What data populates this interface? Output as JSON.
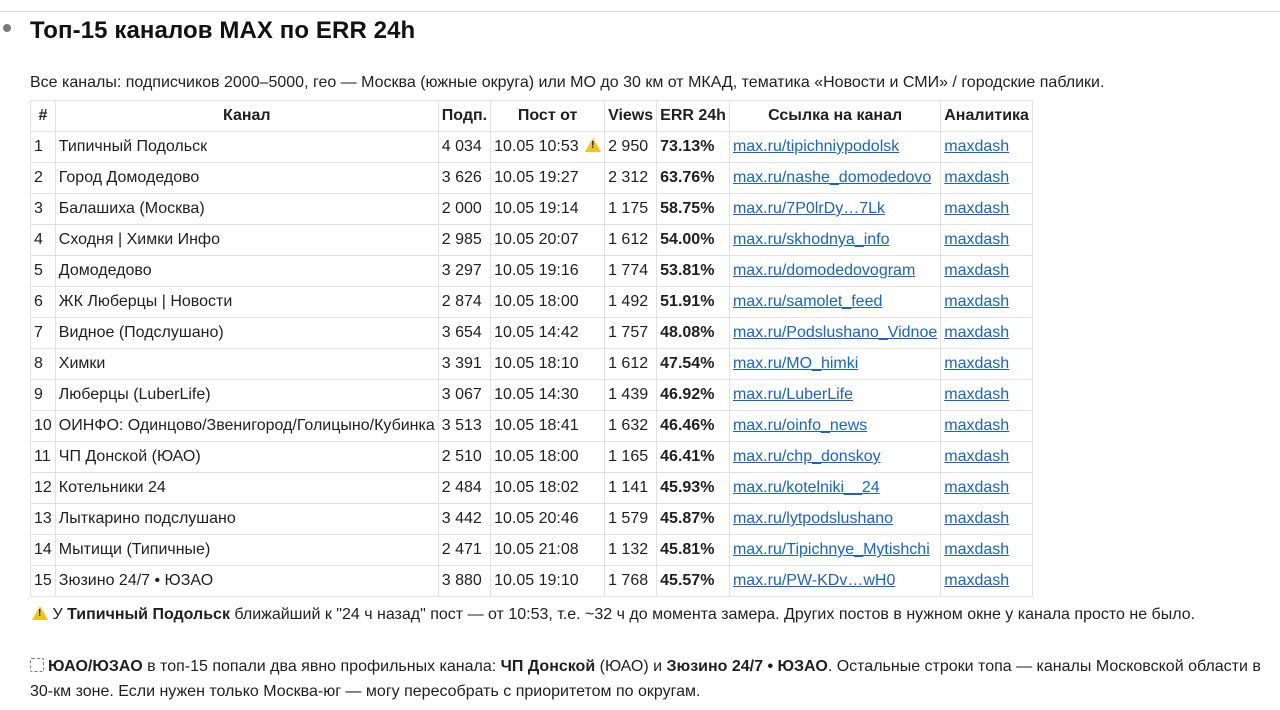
{
  "title": "Топ-15 каналов MAX по ERR 24h",
  "intro": "Все каналы: подписчиков 2000–5000, гео — Москва (южные округа) или МО до 30 км от МКАД, тематика «Новости и СМИ» / городские паблики.",
  "table": {
    "headers": [
      "#",
      "Канал",
      "Подп.",
      "Пост от",
      "Views",
      "ERR 24h",
      "Ссылка на канал",
      "Аналитика"
    ],
    "rows": [
      {
        "n": "1",
        "channel": "Типичный Подольск",
        "subs": "4 034",
        "post": "10.05 10:53",
        "warn": true,
        "views": "2 950",
        "err": "73.13%",
        "link": "max.ru/tipichniypodolsk",
        "analytics": "maxdash"
      },
      {
        "n": "2",
        "channel": "Город Домодедово",
        "subs": "3 626",
        "post": "10.05 19:27",
        "warn": false,
        "views": "2 312",
        "err": "63.76%",
        "link": "max.ru/nashe_domodedovo",
        "analytics": "maxdash"
      },
      {
        "n": "3",
        "channel": "Балашиха (Москва)",
        "subs": "2 000",
        "post": "10.05 19:14",
        "warn": false,
        "views": "1 175",
        "err": "58.75%",
        "link": "max.ru/7P0lrDy…7Lk",
        "analytics": "maxdash"
      },
      {
        "n": "4",
        "channel": "Сходня | Химки Инфо",
        "subs": "2 985",
        "post": "10.05 20:07",
        "warn": false,
        "views": "1 612",
        "err": "54.00%",
        "link": "max.ru/skhodnya_info",
        "analytics": "maxdash"
      },
      {
        "n": "5",
        "channel": "Домодедово",
        "subs": "3 297",
        "post": "10.05 19:16",
        "warn": false,
        "views": "1 774",
        "err": "53.81%",
        "link": "max.ru/domodedovogram",
        "analytics": "maxdash"
      },
      {
        "n": "6",
        "channel": "ЖК Люберцы | Новости",
        "subs": "2 874",
        "post": "10.05 18:00",
        "warn": false,
        "views": "1 492",
        "err": "51.91%",
        "link": "max.ru/samolet_feed",
        "analytics": "maxdash"
      },
      {
        "n": "7",
        "channel": "Видное (Подслушано)",
        "subs": "3 654",
        "post": "10.05 14:42",
        "warn": false,
        "views": "1 757",
        "err": "48.08%",
        "link": "max.ru/Podslushano_Vidnoe",
        "analytics": "maxdash"
      },
      {
        "n": "8",
        "channel": "Химки",
        "subs": "3 391",
        "post": "10.05 18:10",
        "warn": false,
        "views": "1 612",
        "err": "47.54%",
        "link": "max.ru/MO_himki",
        "analytics": "maxdash"
      },
      {
        "n": "9",
        "channel": "Люберцы (LuberLife)",
        "subs": "3 067",
        "post": "10.05 14:30",
        "warn": false,
        "views": "1 439",
        "err": "46.92%",
        "link": "max.ru/LuberLife",
        "analytics": "maxdash"
      },
      {
        "n": "10",
        "channel": "ОИНФО: Одинцово/Звенигород/Голицыно/Кубинка",
        "subs": "3 513",
        "post": "10.05 18:41",
        "warn": false,
        "views": "1 632",
        "err": "46.46%",
        "link": "max.ru/oinfo_news",
        "analytics": "maxdash"
      },
      {
        "n": "11",
        "channel": "ЧП Донской (ЮАО)",
        "subs": "2 510",
        "post": "10.05 18:00",
        "warn": false,
        "views": "1 165",
        "err": "46.41%",
        "link": "max.ru/chp_donskoy",
        "analytics": "maxdash"
      },
      {
        "n": "12",
        "channel": "Котельники 24",
        "subs": "2 484",
        "post": "10.05 18:02",
        "warn": false,
        "views": "1 141",
        "err": "45.93%",
        "link": "max.ru/kotelniki__24",
        "analytics": "maxdash"
      },
      {
        "n": "13",
        "channel": "Лыткарино подслушано",
        "subs": "3 442",
        "post": "10.05 20:46",
        "warn": false,
        "views": "1 579",
        "err": "45.87%",
        "link": "max.ru/lytpodslushano",
        "analytics": "maxdash"
      },
      {
        "n": "14",
        "channel": "Мытищи (Типичные)",
        "subs": "2 471",
        "post": "10.05 21:08",
        "warn": false,
        "views": "1 132",
        "err": "45.81%",
        "link": "max.ru/Tipichnye_Mytishchi",
        "analytics": "maxdash"
      },
      {
        "n": "15",
        "channel": "Зюзино 24/7 • ЮЗАО",
        "subs": "3 880",
        "post": "10.05 19:10",
        "warn": false,
        "views": "1 768",
        "err": "45.57%",
        "link": "max.ru/PW-KDv…wH0",
        "analytics": "maxdash"
      }
    ]
  },
  "note1": {
    "pre": "У ",
    "bold": "Типичный Подольск",
    "post": " ближайший к \"24 ч назад\" пост — от 10:53, т.е. ~32 ч до момента замера. Других постов в нужном окне у канала просто не было."
  },
  "note2": {
    "b1": "ЮАО/ЮЗАО",
    "t1": " в топ-15 попали два явно профильных канала: ",
    "b2": "ЧП Донской",
    "t2": " (ЮАО) и ",
    "b3": "Зюзино 24/7 • ЮЗАО",
    "t3": ". Остальные строки топа — каналы Московской области в 30-км зоне. Если нужен только Москва-юг — могу пересобрать с приоритетом по округам."
  },
  "colors": {
    "link": "#1a63c6",
    "warning": "#f3c21b",
    "border": "#e2e2e2"
  },
  "icons": {
    "warning": "warning-icon",
    "pin": "pin-icon"
  }
}
